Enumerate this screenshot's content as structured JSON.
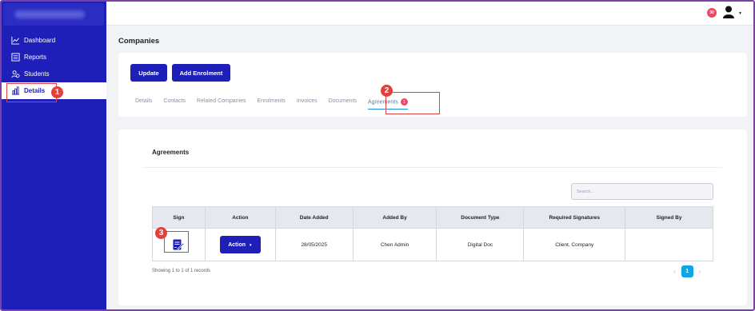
{
  "sidebar": {
    "items": [
      {
        "label": "Dashboard",
        "icon": "chart-line-icon"
      },
      {
        "label": "Reports",
        "icon": "report-icon"
      },
      {
        "label": "Students",
        "icon": "users-icon"
      },
      {
        "label": "Details",
        "icon": "building-chart-icon",
        "active": true
      }
    ]
  },
  "topbar": {
    "notification_count": "30"
  },
  "page": {
    "title": "Companies"
  },
  "toolbar": {
    "update_label": "Update",
    "add_enrolment_label": "Add Enrolment"
  },
  "tabs": [
    {
      "label": "Details"
    },
    {
      "label": "Contacts"
    },
    {
      "label": "Related Companies"
    },
    {
      "label": "Enrolments"
    },
    {
      "label": "Invoices"
    },
    {
      "label": "Documents"
    },
    {
      "label": "Agreements",
      "badge": "1",
      "active": true
    }
  ],
  "annotations": {
    "step1": "1",
    "step2": "2",
    "step3": "3"
  },
  "agreements": {
    "title": "Agreements",
    "search_placeholder": "Search...",
    "columns": [
      "Sign",
      "Action",
      "Date Added",
      "Added By",
      "Document Type",
      "Required Signatures",
      "Signed By"
    ],
    "rows": [
      {
        "action_label": "Action",
        "date_added": "28/05/2025",
        "added_by": "Chen Admin",
        "document_type": "Digital Doc",
        "required_signatures": "Client, Company",
        "signed_by": ""
      }
    ],
    "records_text": "Showing 1 to 1 of 1 records",
    "current_page": "1"
  },
  "colors": {
    "brand": "#1d1fb8",
    "accent": "#1d8fe0",
    "badge": "#ef4766",
    "annotation": "#e0413f"
  }
}
